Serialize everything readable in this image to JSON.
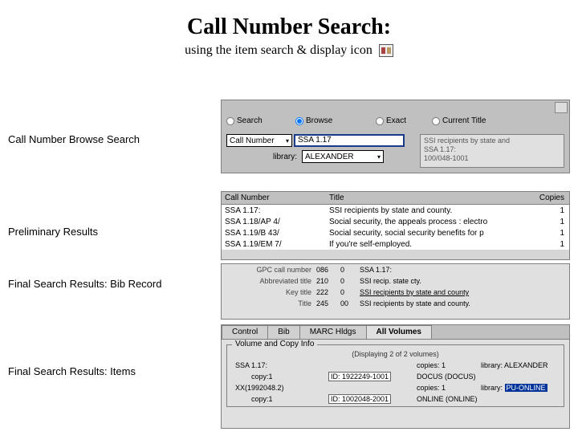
{
  "title": "Call Number Search:",
  "subtitle": "using the item search & display icon",
  "labels": {
    "browse": "Call Number Browse Search",
    "prelim": "Preliminary Results",
    "bib": "Final Search Results: Bib Record",
    "items": "Final Search Results: Items"
  },
  "search": {
    "radios": {
      "search": "Search",
      "browse": "Browse",
      "exact": "Exact",
      "current": "Current Title"
    },
    "selected_radio": "browse",
    "index": "Call Number",
    "term": "SSA 1.17",
    "library_label": "library:",
    "library": "ALEXANDER",
    "result_lines": [
      "SSI recipients by state and",
      "SSA 1.17:",
      "100/048-1001"
    ]
  },
  "prelim": {
    "headers": {
      "callno": "Call Number",
      "title": "Title",
      "copies": "Copies"
    },
    "rows": [
      {
        "callno": "SSA 1.17:",
        "title": "SSI recipients by state and county.",
        "copies": "1"
      },
      {
        "callno": "SSA 1.18/AP 4/",
        "title": "Social security, the appeals process : electro",
        "copies": "1"
      },
      {
        "callno": "SSA 1.19/B 43/",
        "title": "Social security, social security benefits for p",
        "copies": "1"
      },
      {
        "callno": "SSA 1.19/EM 7/",
        "title": "If you're self-employed.",
        "copies": "1"
      }
    ]
  },
  "bib_rows": [
    {
      "label": "GPC call number",
      "tag": "086",
      "ind": "0",
      "value": "SSA 1.17:"
    },
    {
      "label": "Abbreviated title",
      "tag": "210",
      "ind": "0",
      "value": "SSI recip. state cty."
    },
    {
      "label": "Key title",
      "tag": "222",
      "ind": "0",
      "value": "SSI recipients by state and county",
      "link": true
    },
    {
      "label": "Title",
      "tag": "245",
      "ind": "00",
      "value": "SSI recipients by state and county."
    }
  ],
  "items": {
    "tabs": [
      "Control",
      "Bib",
      "MARC Hldgs",
      "All Volumes"
    ],
    "active_tab": 3,
    "group_legend": "Volume and Copy Info",
    "info": "(Displaying 2 of 2 volumes)",
    "vol1": {
      "callno": "SSA 1.17:",
      "copies": "copies: 1",
      "library": "library: ALEXANDER",
      "copy_label": "copy:1",
      "id": "ID: 1922249-1001",
      "loc": "DOCUS (DOCUS)"
    },
    "vol2": {
      "callno": "XX(1992048.2)",
      "copies": "copies: 1",
      "library": "library:",
      "library_hl": "PU-ONLINE",
      "copy_label": "copy:1",
      "id": "ID: 1002048-2001",
      "loc": "ONLINE (ONLINE)"
    }
  }
}
